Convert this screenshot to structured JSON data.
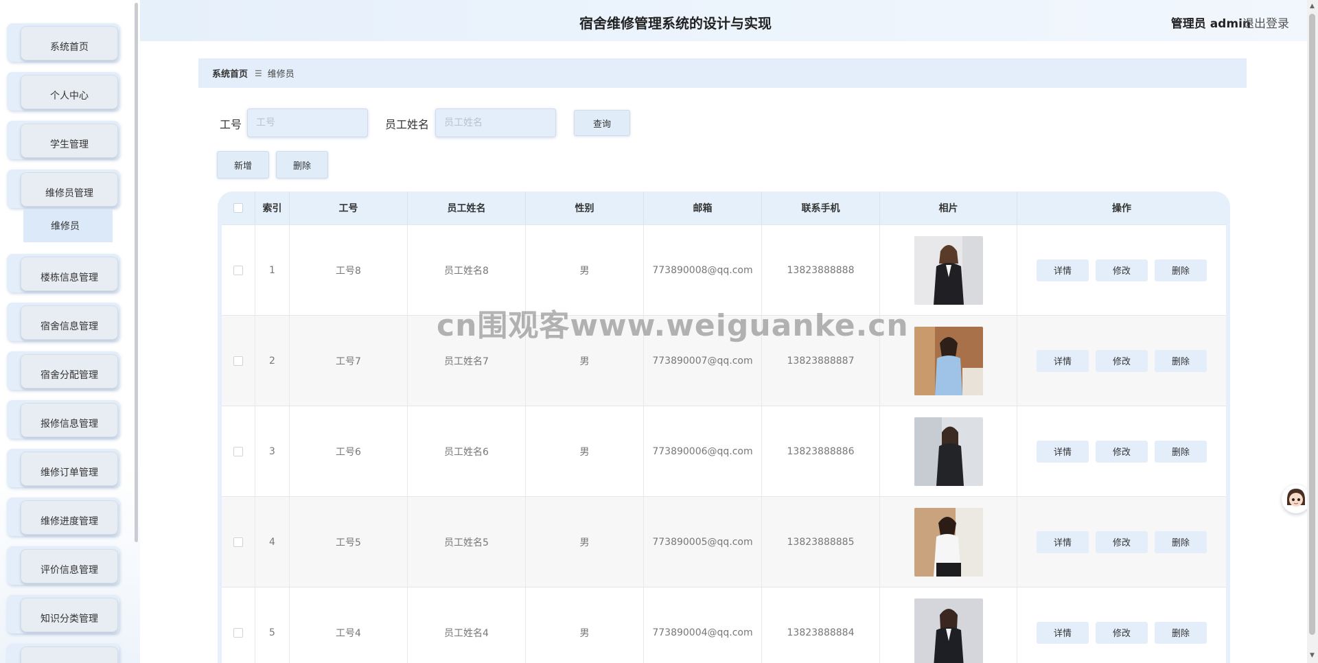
{
  "header": {
    "title": "宿舍维修管理系统的设计与实现",
    "user": "管理员 admin",
    "logout": "退出登录"
  },
  "sidebar": {
    "items": [
      {
        "label": "系统首页"
      },
      {
        "label": "个人中心"
      },
      {
        "label": "学生管理"
      },
      {
        "label": "维修员管理"
      },
      {
        "label": "楼栋信息管理"
      },
      {
        "label": "宿舍信息管理"
      },
      {
        "label": "宿舍分配管理"
      },
      {
        "label": "报修信息管理"
      },
      {
        "label": "维修订单管理"
      },
      {
        "label": "维修进度管理"
      },
      {
        "label": "评价信息管理"
      },
      {
        "label": "知识分类管理"
      }
    ],
    "sub_item": "维修员"
  },
  "breadcrumb": {
    "home": "系统首页",
    "separator": "☰",
    "current": "维修员"
  },
  "search": {
    "id_label": "工号",
    "id_placeholder": "工号",
    "name_label": "员工姓名",
    "name_placeholder": "员工姓名",
    "query_button": "查询"
  },
  "actions": {
    "add": "新增",
    "delete": "删除"
  },
  "table": {
    "headers": [
      "索引",
      "工号",
      "员工姓名",
      "性别",
      "邮箱",
      "联系手机",
      "相片",
      "操作"
    ],
    "row_buttons": {
      "detail": "详情",
      "edit": "修改",
      "delete": "删除"
    },
    "rows": [
      {
        "index": "1",
        "id": "工号8",
        "name": "员工姓名8",
        "gender": "男",
        "email": "773890008@qq.com",
        "phone": "13823888888"
      },
      {
        "index": "2",
        "id": "工号7",
        "name": "员工姓名7",
        "gender": "男",
        "email": "773890007@qq.com",
        "phone": "13823888887"
      },
      {
        "index": "3",
        "id": "工号6",
        "name": "员工姓名6",
        "gender": "男",
        "email": "773890006@qq.com",
        "phone": "13823888886"
      },
      {
        "index": "4",
        "id": "工号5",
        "name": "员工姓名5",
        "gender": "男",
        "email": "773890005@qq.com",
        "phone": "13823888885"
      },
      {
        "index": "5",
        "id": "工号4",
        "name": "员工姓名4",
        "gender": "男",
        "email": "773890004@qq.com",
        "phone": "13823888884"
      }
    ]
  },
  "watermark": "cn围观客www.weiguanke.cn",
  "colors": {
    "accent": "#e3eefa",
    "header_bg": "#e6f0fb",
    "row_alt": "#f7f7f7"
  }
}
